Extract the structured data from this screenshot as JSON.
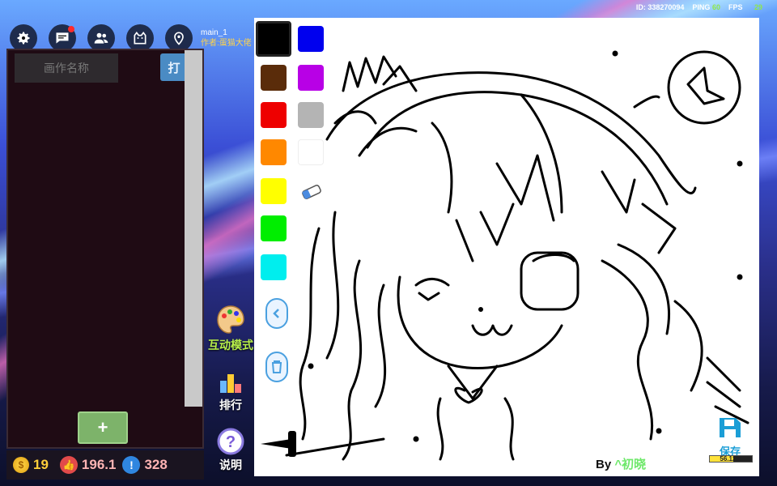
{
  "status": {
    "id_label": "ID:",
    "id_value": "338270094",
    "ping_label": "PING",
    "ping_value": "60",
    "fps_label": "FPS",
    "fps_value": "29"
  },
  "toolbar": {
    "icons": [
      "gear-icon",
      "chat-icon",
      "users-icon",
      "cat-icon",
      "map-pin-icon"
    ]
  },
  "canvas_meta": {
    "name": "main_1",
    "author_label": "作者:",
    "author_value": "蛋猫大佬"
  },
  "left_panel": {
    "name_placeholder": "画作名称",
    "open_button": "打",
    "add_button": "+"
  },
  "stats": {
    "coins": "19",
    "likes": "196.1",
    "reports": "328"
  },
  "middle_menu": [
    {
      "label": "互动模式",
      "icon": "palette-icon"
    },
    {
      "label": "排行",
      "icon": "ranking-icon"
    },
    {
      "label": "说明",
      "icon": "help-icon"
    }
  ],
  "palette": {
    "colors": [
      "#000000",
      "#0000ee",
      "#5a2c0a",
      "#b800e6",
      "#ee0000",
      "#b4b4b4",
      "#ff8800",
      "#ffffff",
      "#ffff00",
      "#00ee00",
      "#00eeee"
    ],
    "selected": "#000000",
    "tools": [
      "eraser-icon",
      "prev-arrow-icon",
      "trash-icon"
    ]
  },
  "save": {
    "label": "保存",
    "progress_text": "56.12%",
    "progress_value": 56.12
  },
  "signature": {
    "by": "By",
    "name": "^初晓"
  },
  "accent": "#4aa0e0"
}
